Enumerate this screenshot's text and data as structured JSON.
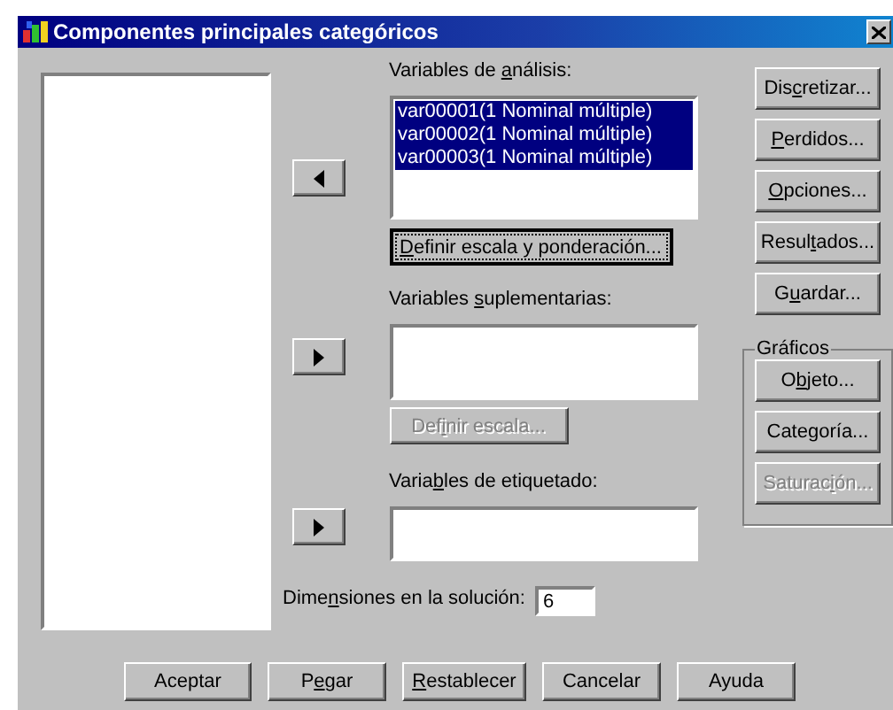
{
  "window": {
    "title": "Componentes principales categóricos"
  },
  "analysis": {
    "label": {
      "pre": "Variables de ",
      "key": "a",
      "post": "nálisis:"
    },
    "items": [
      {
        "text": "var00001(1 Nominal múltiple)",
        "selected": true
      },
      {
        "text": "var00002(1 Nominal múltiple)",
        "selected": true
      },
      {
        "text": "var00003(1 Nominal múltiple)",
        "selected": true
      }
    ],
    "move_button": {
      "kind": "left"
    },
    "button": {
      "label": {
        "key": "D",
        "post": "efinir escala y ponderación..."
      },
      "disabled": false,
      "focused": true
    }
  },
  "supplementary": {
    "label": {
      "pre": "Variables ",
      "key": "s",
      "post": "uplementarias:"
    },
    "move_button": {
      "kind": "right"
    },
    "button": {
      "label": {
        "pre": "Def",
        "key": "i",
        "post": "nir escala..."
      },
      "disabled": true,
      "focused": false
    }
  },
  "labeling": {
    "label": {
      "pre": "Varia",
      "key": "b",
      "post": "les de etiquetado:"
    },
    "move_button": {
      "kind": "right"
    }
  },
  "dimensions": {
    "label": {
      "pre": "Dime",
      "key": "n",
      "post": "siones en la solución:"
    },
    "value": "6"
  },
  "side_buttons": [
    {
      "label": {
        "pre": "Dis",
        "key": "c",
        "post": "retizar..."
      },
      "disabled": false
    },
    {
      "label": {
        "key": "P",
        "post": "erdidos..."
      },
      "disabled": false
    },
    {
      "label": {
        "key": "O",
        "post": "pciones..."
      },
      "disabled": false
    },
    {
      "label": {
        "pre": "Resul",
        "key": "t",
        "post": "ados..."
      },
      "disabled": false
    },
    {
      "label": {
        "pre": "G",
        "key": "u",
        "post": "ardar..."
      },
      "disabled": false
    }
  ],
  "charts_group": {
    "title": "Gráficos",
    "buttons": [
      {
        "label": {
          "pre": "O",
          "key": "b",
          "post": "jeto..."
        },
        "disabled": false
      },
      {
        "label": {
          "pre": "Categoría..."
        },
        "disabled": false
      },
      {
        "label": {
          "pre": "Saturac",
          "key": "i",
          "post": "ón..."
        },
        "disabled": true
      }
    ]
  },
  "footer_buttons": [
    {
      "label": {
        "pre": "Aceptar"
      }
    },
    {
      "label": {
        "pre": "P",
        "key": "e",
        "post": "gar"
      }
    },
    {
      "label": {
        "key": "R",
        "post": "establecer"
      }
    },
    {
      "label": {
        "pre": "Cancelar"
      }
    },
    {
      "label": {
        "pre": "Ayuda"
      }
    }
  ]
}
